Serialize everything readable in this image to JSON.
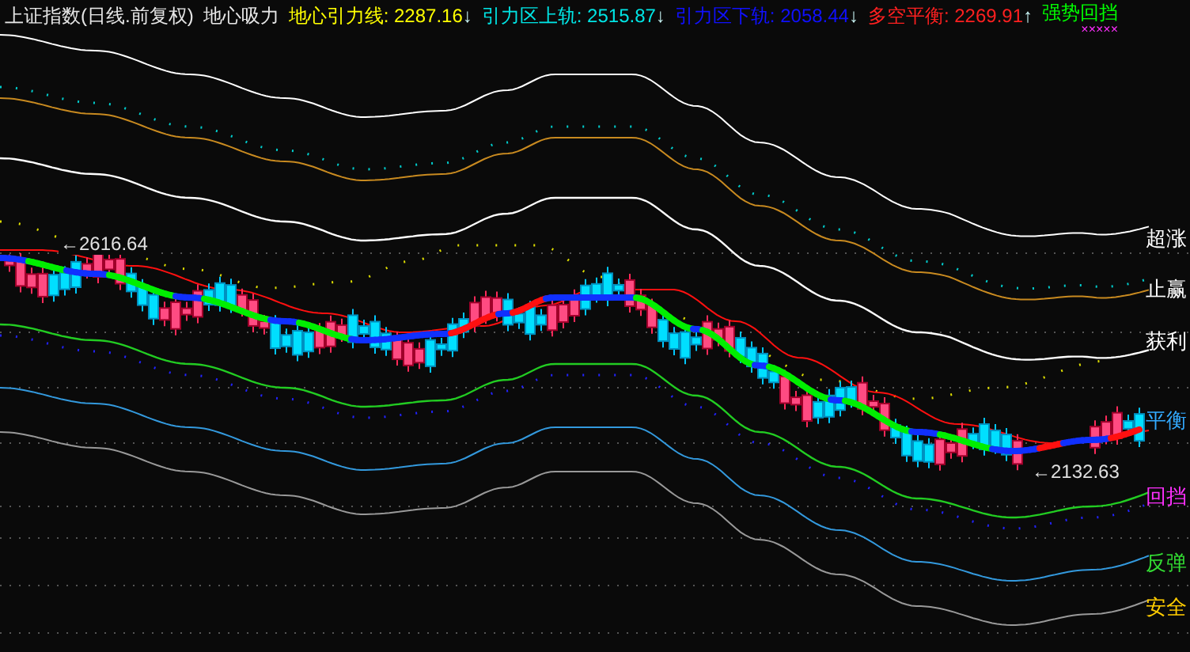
{
  "header": {
    "title": "上证指数(日线.前复权)",
    "indicator": "地心吸力",
    "values": [
      {
        "label": "地心引力线: 2287.16",
        "arrow": "↓",
        "color": "#ffff00"
      },
      {
        "label": "引力区上轨: 2515.87",
        "arrow": "↓",
        "color": "#00e5e5"
      },
      {
        "label": "引力区下轨: 2058.44",
        "arrow": "↓",
        "color": "#1010ff"
      },
      {
        "label": "多空平衡: 2269.91",
        "arrow": "↑",
        "color": "#ff2020"
      }
    ],
    "signal": "强势回挡",
    "signal_marks": "×××××"
  },
  "chart": {
    "band_labels": [
      {
        "label": "超涨",
        "color": "#ffffff"
      },
      {
        "label": "止赢",
        "color": "#ffffff"
      },
      {
        "label": "获利",
        "color": "#ffffff"
      },
      {
        "label": "平衡",
        "color": "#33aaff"
      },
      {
        "label": "回挡",
        "color": "#ff30ff"
      },
      {
        "label": "反弹",
        "color": "#33dd33"
      },
      {
        "label": "安全",
        "color": "#ffcc00"
      }
    ],
    "annotations": [
      "←2616.64",
      "←2132.63"
    ]
  }
}
